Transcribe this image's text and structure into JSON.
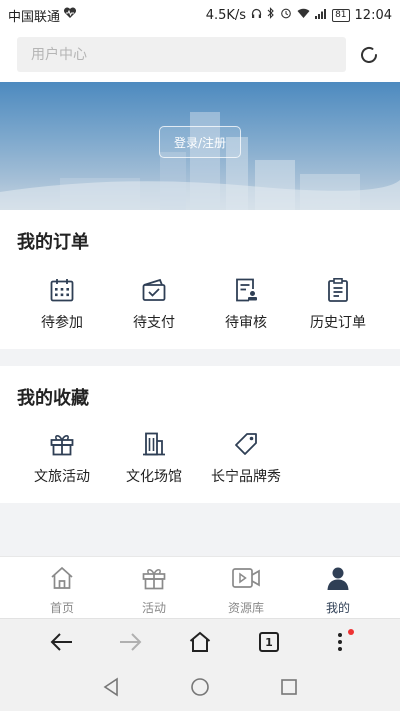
{
  "status_bar": {
    "carrier": "中国联通",
    "speed": "4.5K/s",
    "battery": "81",
    "time": "12:04"
  },
  "search": {
    "placeholder": "用户中心"
  },
  "banner": {
    "login_label": "登录/注册"
  },
  "orders": {
    "title": "我的订单",
    "items": [
      {
        "label": "待参加",
        "icon": "calendar-icon"
      },
      {
        "label": "待支付",
        "icon": "payment-icon"
      },
      {
        "label": "待审核",
        "icon": "review-icon"
      },
      {
        "label": "历史订单",
        "icon": "clipboard-icon"
      }
    ]
  },
  "favorites": {
    "title": "我的收藏",
    "items": [
      {
        "label": "文旅活动",
        "icon": "gift-icon"
      },
      {
        "label": "文化场馆",
        "icon": "building-icon"
      },
      {
        "label": "长宁品牌秀",
        "icon": "tag-icon"
      }
    ]
  },
  "tabbar": {
    "items": [
      {
        "label": "首页",
        "icon": "home-icon"
      },
      {
        "label": "活动",
        "icon": "gift-icon"
      },
      {
        "label": "资源库",
        "icon": "video-icon"
      },
      {
        "label": "我的",
        "icon": "user-icon",
        "active": true
      }
    ]
  },
  "browser": {
    "tab_count": "1"
  },
  "colors": {
    "icon": "#2f3f55",
    "inactive": "#8a8a8a",
    "accent_dot": "#e33333"
  }
}
